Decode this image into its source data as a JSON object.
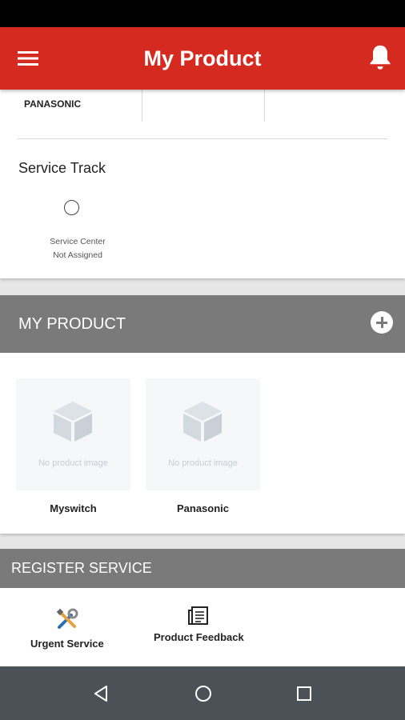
{
  "app_bar": {
    "title": "My Product",
    "menu_icon": "hamburger-menu-icon",
    "bell_icon": "notification-bell-icon",
    "color": "#d42a20"
  },
  "product_info": {
    "brand": "PANASONIC"
  },
  "service_track": {
    "title": "Service Track",
    "status_line1": "Service Center",
    "status_line2": "Not Assigned"
  },
  "my_product_section": {
    "title": "MY PRODUCT",
    "add_icon": "add-circle-icon",
    "products": [
      {
        "name": "Myswitch",
        "placeholder": "No product image"
      },
      {
        "name": "Panasonic",
        "placeholder": "No product image"
      }
    ]
  },
  "register_section": {
    "title": "REGISTER SERVICE",
    "items": [
      {
        "label": "Urgent Service",
        "icon": "tools-icon"
      },
      {
        "label": "Product Feedback",
        "icon": "feedback-document-icon"
      }
    ]
  },
  "colors": {
    "section_header": "#7a7a7a",
    "nav_bar": "#4a5257"
  }
}
